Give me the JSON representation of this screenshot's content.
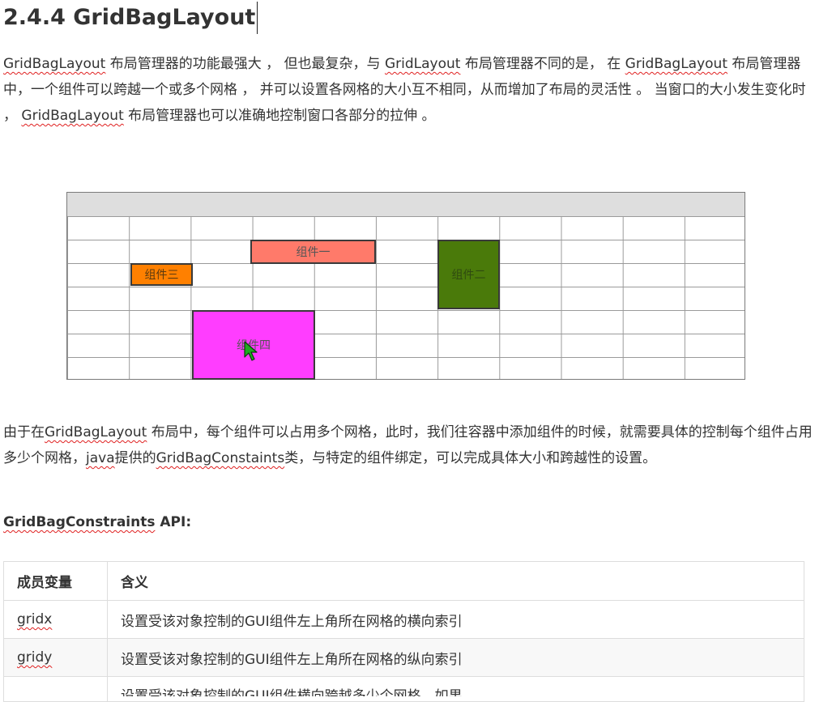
{
  "heading": "2.4.4 GridBagLayout",
  "intro": {
    "part1": "GridBagLayout",
    "part2": " 布局管理器的功能最强大 ， 但也最复杂，与 ",
    "part3": "GridLayout",
    "part4": " 布局管理器不同的是， 在 ",
    "part5": "GridBagLayout",
    "part6": " 布局管理器中，一个组件可以跨越一个或多个网格 ， 并可以设置各网格的大小互不相同，从而增加了布局的灵活性 。 当窗口的大小发生变化时 ， ",
    "part7": "GridBagLayout",
    "part8": " 布局管理器也可以准确地控制窗口各部分的拉伸 。"
  },
  "diagram": {
    "components": [
      {
        "label": "组件一",
        "color": "#ff7a6a"
      },
      {
        "label": "组件二",
        "color": "#4a7a0a"
      },
      {
        "label": "组件三",
        "color": "#ff8000"
      },
      {
        "label": "组件四",
        "color": "#ff3dff"
      }
    ]
  },
  "para2": {
    "part1": "由于在",
    "part2": "GridBagLayout",
    "part3": " 布局中，每个组件可以占用多个网格，此时，我们往容器中添加组件的时候，就需要具体的控制每个组件占用多少个网格，",
    "part4": "java",
    "part5": "提供的",
    "part6": "GridBagConstaints",
    "part7": "类，与特定的组件绑定，可以完成具体大小和跨越性的设置。"
  },
  "api_heading": {
    "name": "GridBagConstraints",
    "suffix": " API:"
  },
  "table": {
    "headers": [
      "成员变量",
      "含义"
    ],
    "rows": [
      {
        "name": "gridx",
        "desc": "设置受该对象控制的GUI组件左上角所在网格的横向索引"
      },
      {
        "name": "gridy",
        "desc": "设置受该对象控制的GUI组件左上角所在网格的纵向索引"
      },
      {
        "name": "",
        "desc": "设置受该对象控制的GUI组件横向跨越多少个网格，如果"
      }
    ]
  }
}
